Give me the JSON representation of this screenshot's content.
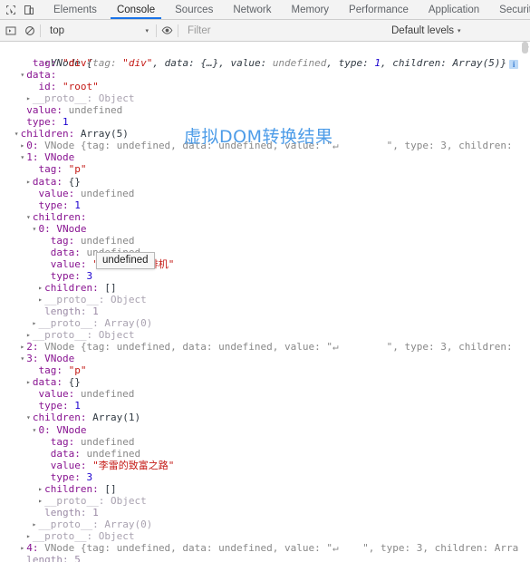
{
  "tabbar": {
    "icons": [
      {
        "name": "inspect-element-icon",
        "glyph": "⬚"
      },
      {
        "name": "device-toolbar-icon",
        "glyph": "▫"
      }
    ],
    "tabs": [
      {
        "label": "Elements",
        "active": false
      },
      {
        "label": "Console",
        "active": true
      },
      {
        "label": "Sources",
        "active": false
      },
      {
        "label": "Network",
        "active": false
      },
      {
        "label": "Memory",
        "active": false
      },
      {
        "label": "Performance",
        "active": false
      },
      {
        "label": "Application",
        "active": false
      },
      {
        "label": "Security",
        "active": false
      }
    ]
  },
  "filterbar": {
    "sidebar_toggle_icon": "▶",
    "clear_console_icon": "⃠",
    "context_value": "top",
    "context_caret": "▾",
    "eye_icon": "◉",
    "filter_placeholder": "Filter",
    "levels_label": "Default levels",
    "levels_caret": "▾"
  },
  "annotation": {
    "text": "虚拟DOM转换结果",
    "color": "#4d9ce8"
  },
  "tooltip": {
    "text": "undefined"
  },
  "colors": {
    "accent": "#1a73e8",
    "string": "#c41a16",
    "number": "#1c00cf",
    "property": "#881391",
    "undefined": "#888888",
    "proto": "#a9a2b0"
  },
  "console_output": {
    "root_summary": {
      "prefix": "VNode {",
      "tag_key": "tag: ",
      "tag_val": "\"div\"",
      "data_part": ", data: {…}, value: ",
      "undef": "undefined",
      "type_part": ", type: ",
      "type_val": "1",
      "children_part": ", children: Array(5)}",
      "info_badge": "i"
    },
    "lines": [
      {
        "indent": 3,
        "tri": "",
        "text": "tag: ",
        "val": "\"div\"",
        "kind": "str"
      },
      {
        "indent": 2,
        "tri": "▾",
        "text": "data:",
        "val": "",
        "kind": "plain"
      },
      {
        "indent": 4,
        "tri": "",
        "text": "id: ",
        "val": "\"root\"",
        "kind": "str"
      },
      {
        "indent": 3,
        "tri": "▸",
        "text": "__proto__: ",
        "val": "Object",
        "kind": "proto"
      },
      {
        "indent": 2,
        "tri": "",
        "text": "value: ",
        "val": "undefined",
        "kind": "dim"
      },
      {
        "indent": 2,
        "tri": "",
        "text": "type: ",
        "val": "1",
        "kind": "num"
      },
      {
        "indent": 1,
        "tri": "▾",
        "text": "children: ",
        "val": "Array(5)",
        "kind": "plain"
      },
      {
        "indent": 2,
        "tri": "▸",
        "text": "0: VNode {tag: undefined, data: undefined, value: \"↵        \", type: 3, children:",
        "val": "",
        "kind": "inline"
      },
      {
        "indent": 2,
        "tri": "▾",
        "text": "1: VNode",
        "val": "",
        "kind": "plain"
      },
      {
        "indent": 4,
        "tri": "",
        "text": "tag: ",
        "val": "\"p\"",
        "kind": "str"
      },
      {
        "indent": 3,
        "tri": "▸",
        "text": "data: ",
        "val": "{}",
        "kind": "plain"
      },
      {
        "indent": 4,
        "tri": "",
        "text": "value: ",
        "val": "undefined",
        "kind": "dim"
      },
      {
        "indent": 4,
        "tri": "",
        "text": "type: ",
        "val": "1",
        "kind": "num"
      },
      {
        "indent": 3,
        "tri": "▾",
        "text": "children:",
        "val": "",
        "kind": "plain"
      },
      {
        "indent": 4,
        "tri": "▾",
        "text": "0: VNode",
        "val": "",
        "kind": "plain"
      },
      {
        "indent": 6,
        "tri": "",
        "text": "tag: ",
        "val": "undefined",
        "kind": "dim"
      },
      {
        "indent": 6,
        "tri": "",
        "text": "data: ",
        "val": "undefined",
        "kind": "dim"
      },
      {
        "indent": 6,
        "tri": "",
        "text": "value: ",
        "val": "\"韩梅梅的咖啡机\"",
        "kind": "str"
      },
      {
        "indent": 6,
        "tri": "",
        "text": "type: ",
        "val": "3",
        "kind": "num"
      },
      {
        "indent": 5,
        "tri": "▸",
        "text": "children: ",
        "val": "[]",
        "kind": "plain"
      },
      {
        "indent": 5,
        "tri": "▸",
        "text": "__proto__: ",
        "val": "Object",
        "kind": "proto"
      },
      {
        "indent": 5,
        "tri": "",
        "text": "length: ",
        "val": "1",
        "kind": "len"
      },
      {
        "indent": 4,
        "tri": "▸",
        "text": "__proto__: ",
        "val": "Array(0)",
        "kind": "proto"
      },
      {
        "indent": 3,
        "tri": "▸",
        "text": "__proto__: ",
        "val": "Object",
        "kind": "proto"
      },
      {
        "indent": 2,
        "tri": "▸",
        "text": "2: VNode {tag: undefined, data: undefined, value: \"↵        \", type: 3, children:",
        "val": "",
        "kind": "inline"
      },
      {
        "indent": 2,
        "tri": "▾",
        "text": "3: VNode",
        "val": "",
        "kind": "plain"
      },
      {
        "indent": 4,
        "tri": "",
        "text": "tag: ",
        "val": "\"p\"",
        "kind": "str"
      },
      {
        "indent": 3,
        "tri": "▸",
        "text": "data: ",
        "val": "{}",
        "kind": "plain"
      },
      {
        "indent": 4,
        "tri": "",
        "text": "value: ",
        "val": "undefined",
        "kind": "dim"
      },
      {
        "indent": 4,
        "tri": "",
        "text": "type: ",
        "val": "1",
        "kind": "num"
      },
      {
        "indent": 3,
        "tri": "▾",
        "text": "children: ",
        "val": "Array(1)",
        "kind": "plain"
      },
      {
        "indent": 4,
        "tri": "▾",
        "text": "0: VNode",
        "val": "",
        "kind": "plain"
      },
      {
        "indent": 6,
        "tri": "",
        "text": "tag: ",
        "val": "undefined",
        "kind": "dim"
      },
      {
        "indent": 6,
        "tri": "",
        "text": "data: ",
        "val": "undefined",
        "kind": "dim"
      },
      {
        "indent": 6,
        "tri": "",
        "text": "value: ",
        "val": "\"李雷的致富之路\"",
        "kind": "str"
      },
      {
        "indent": 6,
        "tri": "",
        "text": "type: ",
        "val": "3",
        "kind": "num"
      },
      {
        "indent": 5,
        "tri": "▸",
        "text": "children: ",
        "val": "[]",
        "kind": "plain"
      },
      {
        "indent": 5,
        "tri": "▸",
        "text": "__proto__: ",
        "val": "Object",
        "kind": "proto"
      },
      {
        "indent": 5,
        "tri": "",
        "text": "length: ",
        "val": "1",
        "kind": "len"
      },
      {
        "indent": 4,
        "tri": "▸",
        "text": "__proto__: ",
        "val": "Array(0)",
        "kind": "proto"
      },
      {
        "indent": 3,
        "tri": "▸",
        "text": "__proto__: ",
        "val": "Object",
        "kind": "proto"
      },
      {
        "indent": 2,
        "tri": "▸",
        "text": "4: VNode {tag: undefined, data: undefined, value: \"↵    \", type: 3, children: Arra",
        "val": "",
        "kind": "inline"
      },
      {
        "indent": 2,
        "tri": "",
        "text": "length: ",
        "val": "5",
        "kind": "len"
      }
    ]
  }
}
